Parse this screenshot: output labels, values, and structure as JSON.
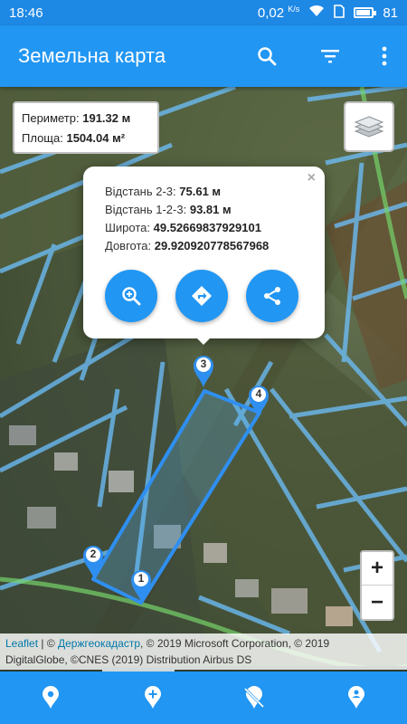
{
  "status_bar": {
    "time": "18:46",
    "speed": "0,02",
    "speed_unit": "K/s",
    "battery": "81"
  },
  "app_bar": {
    "title": "Земельна карта",
    "icons": [
      "search-icon",
      "filter-icon",
      "more-vert-icon"
    ]
  },
  "info": {
    "perimeter_label": "Периметр:",
    "perimeter_value": "191.32 м",
    "area_label": "Площа:",
    "area_value": "1504.04 м²"
  },
  "popup": {
    "close": "×",
    "distance_23_label": "Відстань 2-3:",
    "distance_23_value": "75.61 м",
    "distance_123_label": "Відстань 1-2-3:",
    "distance_123_value": "93.81 м",
    "lat_label": "Широта:",
    "lat_value": "49.52669837929101",
    "lon_label": "Довгота:",
    "lon_value": "29.920920778567968",
    "buttons": [
      "zoom-in-icon",
      "directions-icon",
      "share-icon"
    ]
  },
  "markers": [
    "1",
    "2",
    "3",
    "4"
  ],
  "zoom": {
    "in": "+",
    "out": "−"
  },
  "attribution": {
    "leaflet": "Leaflet",
    "sep": " | © ",
    "provider": "Держгеокадастр",
    "rest1": ", © 2019 Microsoft Corporation, © 2019",
    "rest2": "DigitalGlobe, ©CNES (2019) Distribution Airbus DS"
  },
  "bottom_nav": [
    "place-icon",
    "add-location-icon",
    "location-off-icon",
    "person-pin-icon"
  ],
  "colors": {
    "primary": "#2196f3",
    "status": "#1e88e5",
    "parcel": "#4fb3ff"
  }
}
